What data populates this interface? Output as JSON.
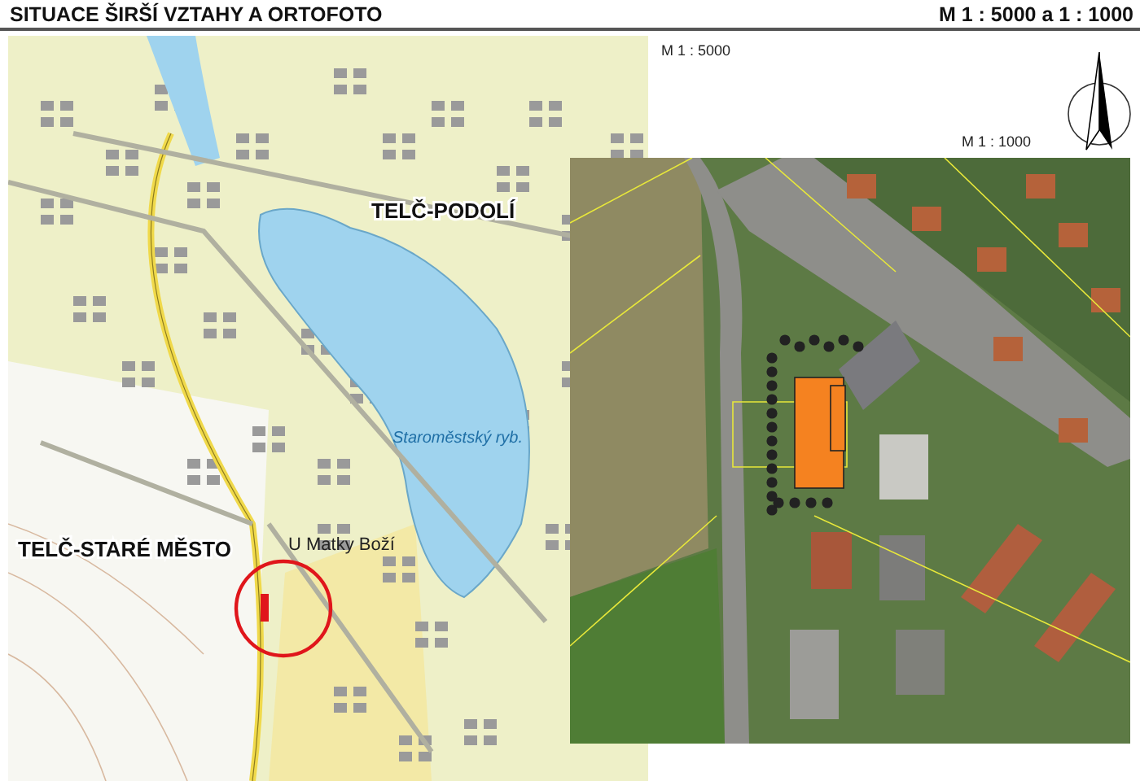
{
  "header": {
    "title": "SITUACE ŠIRŠÍ VZTAHY A ORTOFOTO",
    "scale": "M 1 : 5000 a 1 : 1000"
  },
  "topo_map": {
    "scale_label": "M 1 : 5000",
    "site_marked": true,
    "labels": [
      {
        "kind": "place",
        "text": "TELČ-PODOLÍ"
      },
      {
        "kind": "water",
        "text": "Staroměstský ryb."
      },
      {
        "kind": "place",
        "text": "TELČ-STARÉ MĚSTO"
      },
      {
        "kind": "locality",
        "text": "U Matky Boží"
      }
    ]
  },
  "orthophoto": {
    "scale_label": "M 1 : 1000"
  }
}
